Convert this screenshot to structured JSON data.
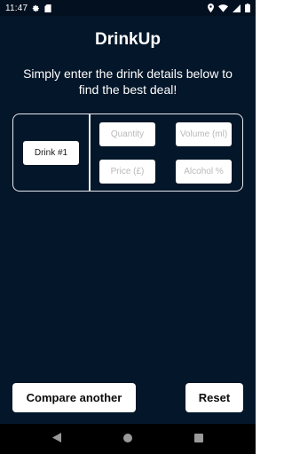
{
  "status_bar": {
    "time": "11:47",
    "icons": [
      "gear-icon",
      "sd-card-icon",
      "location-icon",
      "wifi-icon",
      "cell-signal-icon",
      "battery-icon"
    ]
  },
  "header": {
    "title": "DrinkUp",
    "subtitle": "Simply enter the drink details below to find the best deal!"
  },
  "drink_entry": {
    "label": "Drink #1",
    "fields": {
      "quantity": {
        "value": "",
        "placeholder": "Quantity"
      },
      "volume": {
        "value": "",
        "placeholder": "Volume (ml)"
      },
      "price": {
        "value": "",
        "placeholder": "Price (£)"
      },
      "alcohol": {
        "value": "",
        "placeholder": "Alcohol %"
      }
    }
  },
  "actions": {
    "compare_label": "Compare another",
    "reset_label": "Reset"
  },
  "nav_bar": {
    "icons": [
      "back-icon",
      "home-icon",
      "recents-icon"
    ]
  },
  "colors": {
    "background": "#041629",
    "status_bar": "#03101f",
    "card_border": "#e6e9ee",
    "button_bg": "#ffffff",
    "placeholder": "#b9b9b9"
  }
}
